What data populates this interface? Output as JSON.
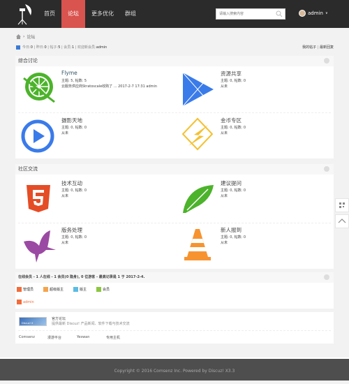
{
  "header": {
    "nav": [
      {
        "label": "首页"
      },
      {
        "label": "论坛",
        "active": true
      },
      {
        "label": "更多优化"
      },
      {
        "label": "群组"
      }
    ],
    "search_placeholder": "请输入搜索内容",
    "user": "admin",
    "accent": "#d9534f"
  },
  "breadcrumb": {
    "current": "论坛"
  },
  "stats": {
    "today_label": "今日:",
    "today": "0",
    "yesterday_label": "昨日:",
    "yesterday": "0",
    "posts_label": "帖子:",
    "posts": "5",
    "members_label": "会员:",
    "members": "1",
    "welcome_label": "欢迎新会员:",
    "welcome": "admin",
    "my_posts": "我的帖子",
    "latest": "最新回复"
  },
  "sections": [
    {
      "title": "综合讨论",
      "forums": [
        {
          "name": "Flyme",
          "icon": "lime-icon",
          "counts": "主题: 5, 帖数: 5",
          "last": "云服务供应商Stratoscale收购了 ... 2017-2-7 17:31 admin"
        },
        {
          "name": "资源共享",
          "icon": "play-store-icon",
          "counts": "主题: 0, 帖数: 0",
          "last": "从未"
        },
        {
          "name": "摄影天地",
          "icon": "play-circle-icon",
          "counts": "主题: 0, 帖数: 0",
          "last": "从未"
        },
        {
          "name": "金币专区",
          "icon": "lightning-icon",
          "counts": "主题: 0, 帖数: 0",
          "last": "从未"
        }
      ]
    },
    {
      "title": "社区交流",
      "forums": [
        {
          "name": "技术互动",
          "icon": "html5-icon",
          "counts": "主题: 0, 帖数: 0",
          "last": "从未"
        },
        {
          "name": "建议提问",
          "icon": "feather-icon",
          "counts": "主题: 0, 帖数: 0",
          "last": "从未"
        },
        {
          "name": "版务处理",
          "icon": "butterfly-icon",
          "counts": "主题: 0, 帖数: 0",
          "last": "从未"
        },
        {
          "name": "新人报到",
          "icon": "traffic-cone-icon",
          "counts": "主题: 0, 帖数: 0",
          "last": "从未"
        }
      ]
    }
  ],
  "online": {
    "title": "在线会员 - 1 人在线 - 1 会员(0 隐身), 0 位游客 - 最高记录是 1 于 2017-2-4.",
    "legend": [
      {
        "label": "管理员",
        "color": "#f26c3b"
      },
      {
        "label": "超级版主",
        "color": "#f5a44c"
      },
      {
        "label": "版主",
        "color": "#5bbce4"
      },
      {
        "label": "会员",
        "color": "#8cc63f"
      }
    ],
    "users": [
      "admin"
    ]
  },
  "links": {
    "official_title": "官方论坛",
    "official_desc": "提供最新 Discuz! 产品新闻、软件下载与技术交流",
    "logo_text": "Discuz! X",
    "items": [
      "Comsenz",
      "漫游平台",
      "Yeswan",
      "专用主机"
    ]
  },
  "footer": {
    "copyright": "Copyright © 2016 Comsenz Inc.  Powered by Discuz! X3.3"
  }
}
